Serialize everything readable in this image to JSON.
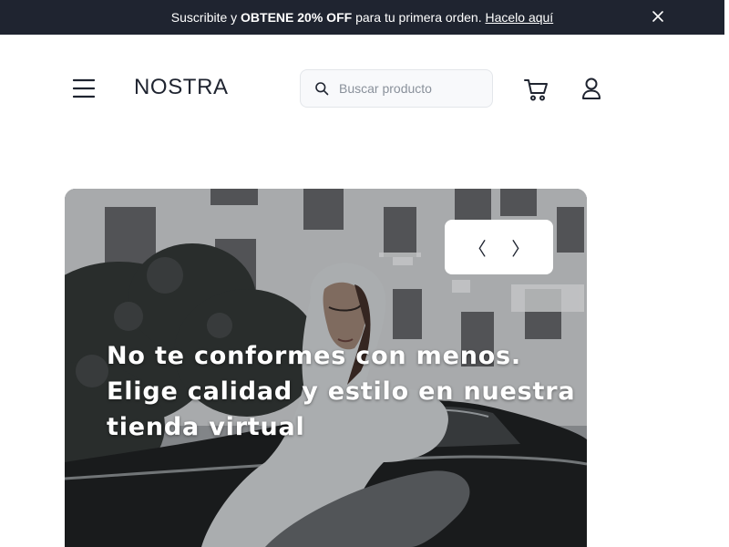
{
  "promo": {
    "text_pre": "Suscribite y ",
    "text_bold": "OBTENE 20% OFF",
    "text_post": " para tu primera orden. ",
    "link": "Hacelo aquí",
    "close_icon": "close-icon"
  },
  "header": {
    "logo": "NOSTRA",
    "menu_icon": "hamburger-menu-icon",
    "cart_icon": "shopping-cart-icon",
    "user_icon": "user-icon"
  },
  "search": {
    "placeholder": "Buscar producto",
    "value": "",
    "icon": "search-icon"
  },
  "hero": {
    "headline": "No te conformes con menos. Elige calidad y estilo en nuestra tienda virtual",
    "prev_label": "〈",
    "next_label": "〉",
    "image": "woman-in-hooded-cardigan-sitting-on-car-photo"
  },
  "colors": {
    "promo_bg": "#1f2430",
    "text_dark": "#1f2430",
    "search_bg": "#f8f9fb",
    "search_border": "#e3e6ea",
    "placeholder": "#8a919b"
  }
}
